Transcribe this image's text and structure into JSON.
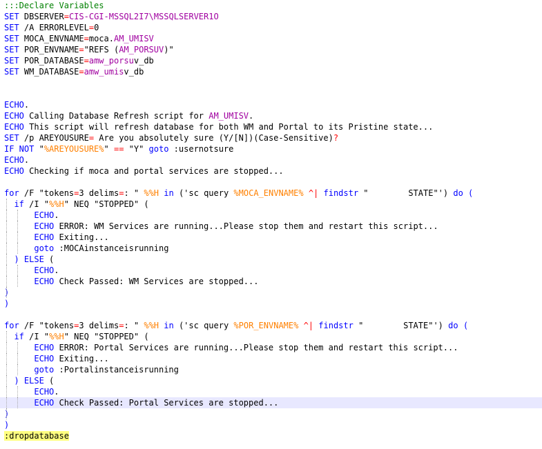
{
  "colors": {
    "background": "#ffffff",
    "comment": "#008000",
    "keyword": "#0000ff",
    "operator": "#ff0000",
    "variable": "#ff8000",
    "current_line": "#e8e8ff",
    "label_highlight": "#ffff80"
  },
  "lines": [
    {
      "guides": [],
      "tokens": [
        {
          "c": "com",
          "t": ":::Declare Variables"
        }
      ]
    },
    {
      "guides": [],
      "tokens": [
        {
          "c": "kw",
          "t": "SET"
        },
        {
          "c": "txt",
          "t": " DBSERVER"
        },
        {
          "c": "op",
          "t": "="
        },
        {
          "c": "red",
          "t": "CIS-CGI-MSSQL2I7\\MSSQLSERVER1O"
        }
      ]
    },
    {
      "guides": [],
      "tokens": [
        {
          "c": "kw",
          "t": "SET"
        },
        {
          "c": "txt",
          "t": " /A ERRORLEVEL"
        },
        {
          "c": "op",
          "t": "="
        },
        {
          "c": "txt",
          "t": "0"
        }
      ]
    },
    {
      "guides": [],
      "tokens": [
        {
          "c": "kw",
          "t": "SET"
        },
        {
          "c": "txt",
          "t": " MOCA_ENVNAME"
        },
        {
          "c": "op",
          "t": "="
        },
        {
          "c": "txt",
          "t": "moca."
        },
        {
          "c": "red",
          "t": "AM_UMISV"
        }
      ]
    },
    {
      "guides": [],
      "tokens": [
        {
          "c": "kw",
          "t": "SET"
        },
        {
          "c": "txt",
          "t": " POR_ENVNAME"
        },
        {
          "c": "op",
          "t": "="
        },
        {
          "c": "txt",
          "t": "\"REFS ("
        },
        {
          "c": "red",
          "t": "AM_PORSUV"
        },
        {
          "c": "txt",
          "t": ")\""
        }
      ]
    },
    {
      "guides": [],
      "tokens": [
        {
          "c": "kw",
          "t": "SET"
        },
        {
          "c": "txt",
          "t": " POR_DATABASE"
        },
        {
          "c": "op",
          "t": "="
        },
        {
          "c": "red",
          "t": "amw_porsu"
        },
        {
          "c": "txt",
          "t": "v_db"
        }
      ]
    },
    {
      "guides": [],
      "tokens": [
        {
          "c": "kw",
          "t": "SET"
        },
        {
          "c": "txt",
          "t": " WM_DATABASE"
        },
        {
          "c": "op",
          "t": "="
        },
        {
          "c": "red",
          "t": "amw_umis"
        },
        {
          "c": "txt",
          "t": "v_db"
        }
      ]
    },
    {
      "guides": [],
      "tokens": []
    },
    {
      "guides": [],
      "tokens": []
    },
    {
      "guides": [],
      "tokens": [
        {
          "c": "kw",
          "t": "ECHO"
        },
        {
          "c": "txt",
          "t": "."
        }
      ]
    },
    {
      "guides": [],
      "tokens": [
        {
          "c": "kw",
          "t": "ECHO"
        },
        {
          "c": "txt",
          "t": " Calling Database Refresh script for "
        },
        {
          "c": "red",
          "t": "AM_UMISV"
        },
        {
          "c": "txt",
          "t": "."
        }
      ]
    },
    {
      "guides": [],
      "tokens": [
        {
          "c": "kw",
          "t": "ECHO"
        },
        {
          "c": "txt",
          "t": " This script will refresh database for both WM and Portal to its Pristine state..."
        }
      ]
    },
    {
      "guides": [],
      "tokens": [
        {
          "c": "kw",
          "t": "SET"
        },
        {
          "c": "txt",
          "t": " /p AREYOUSURE"
        },
        {
          "c": "op",
          "t": "="
        },
        {
          "c": "txt",
          "t": " Are you absolutely sure (Y/[N])(Case-Sensitive)"
        },
        {
          "c": "op",
          "t": "?"
        }
      ]
    },
    {
      "guides": [],
      "tokens": [
        {
          "c": "kw",
          "t": "IF NOT"
        },
        {
          "c": "txt",
          "t": " \""
        },
        {
          "c": "var",
          "t": "%AREYOUSURE%"
        },
        {
          "c": "txt",
          "t": "\" "
        },
        {
          "c": "op",
          "t": "=="
        },
        {
          "c": "txt",
          "t": " \"Y\" "
        },
        {
          "c": "kw",
          "t": "goto"
        },
        {
          "c": "txt",
          "t": " :usernotsure"
        }
      ]
    },
    {
      "guides": [],
      "tokens": [
        {
          "c": "kw",
          "t": "ECHO"
        },
        {
          "c": "txt",
          "t": "."
        }
      ]
    },
    {
      "guides": [],
      "tokens": [
        {
          "c": "kw",
          "t": "ECHO"
        },
        {
          "c": "txt",
          "t": " Checking if moca and portal services are stopped..."
        }
      ]
    },
    {
      "guides": [],
      "tokens": []
    },
    {
      "guides": [],
      "tokens": [
        {
          "c": "kw",
          "t": "for"
        },
        {
          "c": "txt",
          "t": " /F \"tokens"
        },
        {
          "c": "op",
          "t": "="
        },
        {
          "c": "txt",
          "t": "3 delims"
        },
        {
          "c": "op",
          "t": "="
        },
        {
          "c": "txt",
          "t": ": \" "
        },
        {
          "c": "var",
          "t": "%%H"
        },
        {
          "c": "txt",
          "t": " "
        },
        {
          "c": "kw",
          "t": "in"
        },
        {
          "c": "txt",
          "t": " ('sc query "
        },
        {
          "c": "var",
          "t": "%MOCA_ENVNAME%"
        },
        {
          "c": "txt",
          "t": " "
        },
        {
          "c": "op",
          "t": "^|"
        },
        {
          "c": "txt",
          "t": " "
        },
        {
          "c": "kw",
          "t": "findstr"
        },
        {
          "c": "txt",
          "t": " \"        STATE\"') "
        },
        {
          "c": "kw",
          "t": "do"
        },
        {
          "c": "txt",
          "t": " "
        },
        {
          "c": "kw",
          "t": "("
        }
      ]
    },
    {
      "guides": [
        1
      ],
      "tokens": [
        {
          "c": "txt",
          "t": "  "
        },
        {
          "c": "kw",
          "t": "if"
        },
        {
          "c": "txt",
          "t": " /I \""
        },
        {
          "c": "var",
          "t": "%%H"
        },
        {
          "c": "txt",
          "t": "\" NEQ \"STOPPED\" ("
        }
      ]
    },
    {
      "guides": [
        1,
        2
      ],
      "tokens": [
        {
          "c": "txt",
          "t": "      "
        },
        {
          "c": "kw",
          "t": "ECHO"
        },
        {
          "c": "txt",
          "t": "."
        }
      ]
    },
    {
      "guides": [
        1,
        2
      ],
      "tokens": [
        {
          "c": "txt",
          "t": "      "
        },
        {
          "c": "kw",
          "t": "ECHO"
        },
        {
          "c": "txt",
          "t": " ERROR: WM Services are running...Please stop them and restart this script..."
        }
      ]
    },
    {
      "guides": [
        1,
        2
      ],
      "tokens": [
        {
          "c": "txt",
          "t": "      "
        },
        {
          "c": "kw",
          "t": "ECHO"
        },
        {
          "c": "txt",
          "t": " Exiting..."
        }
      ]
    },
    {
      "guides": [
        1,
        2
      ],
      "tokens": [
        {
          "c": "txt",
          "t": "      "
        },
        {
          "c": "kw",
          "t": "goto"
        },
        {
          "c": "txt",
          "t": " :MOCAinstanceisrunning"
        }
      ]
    },
    {
      "guides": [
        1
      ],
      "tokens": [
        {
          "c": "txt",
          "t": "  "
        },
        {
          "c": "kw",
          "t": ")"
        },
        {
          "c": "txt",
          "t": " "
        },
        {
          "c": "kw",
          "t": "ELSE"
        },
        {
          "c": "txt",
          "t": " ("
        }
      ]
    },
    {
      "guides": [
        1,
        2
      ],
      "tokens": [
        {
          "c": "txt",
          "t": "      "
        },
        {
          "c": "kw",
          "t": "ECHO"
        },
        {
          "c": "txt",
          "t": "."
        }
      ]
    },
    {
      "guides": [
        1,
        2
      ],
      "tokens": [
        {
          "c": "txt",
          "t": "      "
        },
        {
          "c": "kw",
          "t": "ECHO"
        },
        {
          "c": "txt",
          "t": " Check Passed: WM Services are stopped..."
        }
      ]
    },
    {
      "guides": [
        1
      ],
      "tokens": [
        {
          "c": "kw",
          "t": ")"
        }
      ]
    },
    {
      "guides": [],
      "tokens": [
        {
          "c": "kw",
          "t": ")"
        }
      ]
    },
    {
      "guides": [],
      "tokens": []
    },
    {
      "guides": [],
      "tokens": [
        {
          "c": "kw",
          "t": "for"
        },
        {
          "c": "txt",
          "t": " /F \"tokens"
        },
        {
          "c": "op",
          "t": "="
        },
        {
          "c": "txt",
          "t": "3 delims"
        },
        {
          "c": "op",
          "t": "="
        },
        {
          "c": "txt",
          "t": ": \" "
        },
        {
          "c": "var",
          "t": "%%H"
        },
        {
          "c": "txt",
          "t": " "
        },
        {
          "c": "kw",
          "t": "in"
        },
        {
          "c": "txt",
          "t": " ('sc query "
        },
        {
          "c": "var",
          "t": "%POR_ENVNAME%"
        },
        {
          "c": "txt",
          "t": " "
        },
        {
          "c": "op",
          "t": "^|"
        },
        {
          "c": "txt",
          "t": " "
        },
        {
          "c": "kw",
          "t": "findstr"
        },
        {
          "c": "txt",
          "t": " \"        STATE\"') "
        },
        {
          "c": "kw",
          "t": "do"
        },
        {
          "c": "txt",
          "t": " "
        },
        {
          "c": "kw",
          "t": "("
        }
      ]
    },
    {
      "guides": [
        1
      ],
      "tokens": [
        {
          "c": "txt",
          "t": "  "
        },
        {
          "c": "kw",
          "t": "if"
        },
        {
          "c": "txt",
          "t": " /I \""
        },
        {
          "c": "var",
          "t": "%%H"
        },
        {
          "c": "txt",
          "t": "\" NEQ \"STOPPED\" ("
        }
      ]
    },
    {
      "guides": [
        1,
        2
      ],
      "tokens": [
        {
          "c": "txt",
          "t": "      "
        },
        {
          "c": "kw",
          "t": "ECHO"
        },
        {
          "c": "txt",
          "t": " ERROR: Portal Services are running...Please stop them and restart this script..."
        }
      ]
    },
    {
      "guides": [
        1,
        2
      ],
      "tokens": [
        {
          "c": "txt",
          "t": "      "
        },
        {
          "c": "kw",
          "t": "ECHO"
        },
        {
          "c": "txt",
          "t": " Exiting..."
        }
      ]
    },
    {
      "guides": [
        1,
        2
      ],
      "tokens": [
        {
          "c": "txt",
          "t": "      "
        },
        {
          "c": "kw",
          "t": "goto"
        },
        {
          "c": "txt",
          "t": " :Portalinstanceisrunning"
        }
      ]
    },
    {
      "guides": [
        1
      ],
      "tokens": [
        {
          "c": "txt",
          "t": "  "
        },
        {
          "c": "kw",
          "t": ")"
        },
        {
          "c": "txt",
          "t": " "
        },
        {
          "c": "kw",
          "t": "ELSE"
        },
        {
          "c": "txt",
          "t": " ("
        }
      ]
    },
    {
      "guides": [
        1,
        2
      ],
      "tokens": [
        {
          "c": "txt",
          "t": "      "
        },
        {
          "c": "kw",
          "t": "ECHO"
        },
        {
          "c": "txt",
          "t": "."
        }
      ]
    },
    {
      "guides": [
        1,
        2
      ],
      "current": true,
      "tokens": [
        {
          "c": "txt",
          "t": "      "
        },
        {
          "c": "kw",
          "t": "ECHO"
        },
        {
          "c": "txt",
          "t": " Check Passed: Portal Services are stopped..."
        }
      ]
    },
    {
      "guides": [
        1
      ],
      "tokens": [
        {
          "c": "kw",
          "t": ")"
        }
      ]
    },
    {
      "guides": [],
      "tokens": [
        {
          "c": "kw",
          "t": ")"
        }
      ]
    },
    {
      "guides": [],
      "tokens": [
        {
          "c": "label",
          "t": ":dropdatabase"
        }
      ]
    }
  ]
}
